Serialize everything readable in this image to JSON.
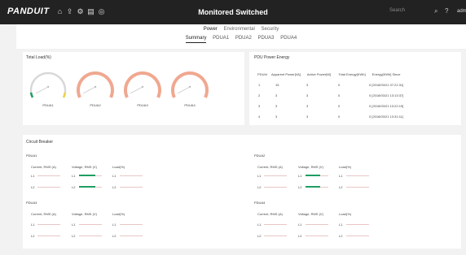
{
  "colors": {
    "topbar": "#222222",
    "accent": "#2a9d7a",
    "gauge_arc": "#f0a890",
    "green": "#1e9e63",
    "yellow": "#e8d44a"
  },
  "header": {
    "logo": "PANDUIT",
    "title": "Monitored Switched",
    "search_placeholder": "Search",
    "user": "admin",
    "icons": [
      "home-icon",
      "upload-icon",
      "settings-icon",
      "calendar-icon",
      "globe-icon",
      "search-icon",
      "help-icon"
    ]
  },
  "nav": {
    "main_tabs": [
      {
        "label": "Power",
        "active": true
      },
      {
        "label": "Environmental",
        "active": false
      },
      {
        "label": "Security",
        "active": false
      }
    ],
    "sub_tabs": [
      {
        "label": "Summary",
        "active": true
      },
      {
        "label": "PDUA1",
        "active": false
      },
      {
        "label": "PDUA2",
        "active": false
      },
      {
        "label": "PDUA3",
        "active": false
      },
      {
        "label": "PDUA4",
        "active": false
      }
    ]
  },
  "total_load": {
    "title": "Total Load(%)",
    "gauges": [
      {
        "label": "PDUA1",
        "value": 0.0
      },
      {
        "label": "PDUA2",
        "value": 0.0
      },
      {
        "label": "PDUA3",
        "value": 0.0
      },
      {
        "label": "PDUA4",
        "value": 0.0
      }
    ]
  },
  "pdu_energy": {
    "title": "PDU Power Energy",
    "columns": [
      "PDUId",
      "Apparent Power[VA]",
      "Active Power[W]",
      "Total Energy[KWh]",
      "Energy[KWh] Since"
    ],
    "rows": [
      [
        "1",
        "15",
        "3",
        "0",
        "0 [2018/03/21 07:21:31]"
      ],
      [
        "2",
        "3",
        "3",
        "0",
        "0 [2018/03/21 13:13:37]"
      ],
      [
        "3",
        "3",
        "3",
        "0",
        "0 [2018/03/21 13:22:19]"
      ],
      [
        "4",
        "3",
        "3",
        "0",
        "0 [2018/03/21 13:31:11]"
      ]
    ]
  },
  "circuit": {
    "title": "Circuit Breaker",
    "columns": [
      "Current, RMS (A)",
      "Voltage, RMS (V)",
      "Load(%)"
    ],
    "pdus": [
      {
        "name": "PDUA1",
        "rows": [
          "L1",
          "L2"
        ]
      },
      {
        "name": "PDUA2",
        "rows": [
          "L1",
          "L2"
        ]
      },
      {
        "name": "PDUA3",
        "rows": [
          "L1",
          "L2"
        ]
      },
      {
        "name": "PDUA4",
        "rows": [
          "L1",
          "L2"
        ]
      }
    ]
  }
}
